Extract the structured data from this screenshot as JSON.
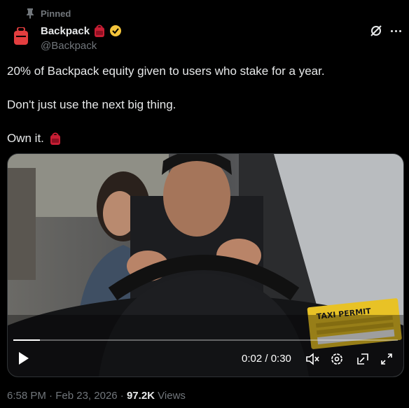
{
  "pinned_label": "Pinned",
  "author": {
    "name": "Backpack",
    "handle": "@Backpack"
  },
  "tweet": {
    "line1": "20% of Backpack equity given to users who stake for a year.",
    "line2": "Don't just use the next big thing.",
    "line3": "Own it."
  },
  "video": {
    "time_display": "0:02 / 0:30",
    "progress": 0.07,
    "permit_sign": "TAXI PERMIT"
  },
  "footer": {
    "time": "6:58 PM",
    "separator": " · ",
    "date": "Feb 23, 2026",
    "views_count": "97.2K",
    "views_label": "Views"
  },
  "colors": {
    "brand": "#e33e3f",
    "verified": "#f4c43b",
    "muted": "#71767b"
  },
  "icons": [
    "pin-icon",
    "backpack-logo",
    "backpack-emoji-icon",
    "verified-badge-icon",
    "grok-icon",
    "more-icon",
    "play-icon",
    "mute-icon",
    "settings-icon",
    "pip-icon",
    "fullscreen-icon"
  ]
}
